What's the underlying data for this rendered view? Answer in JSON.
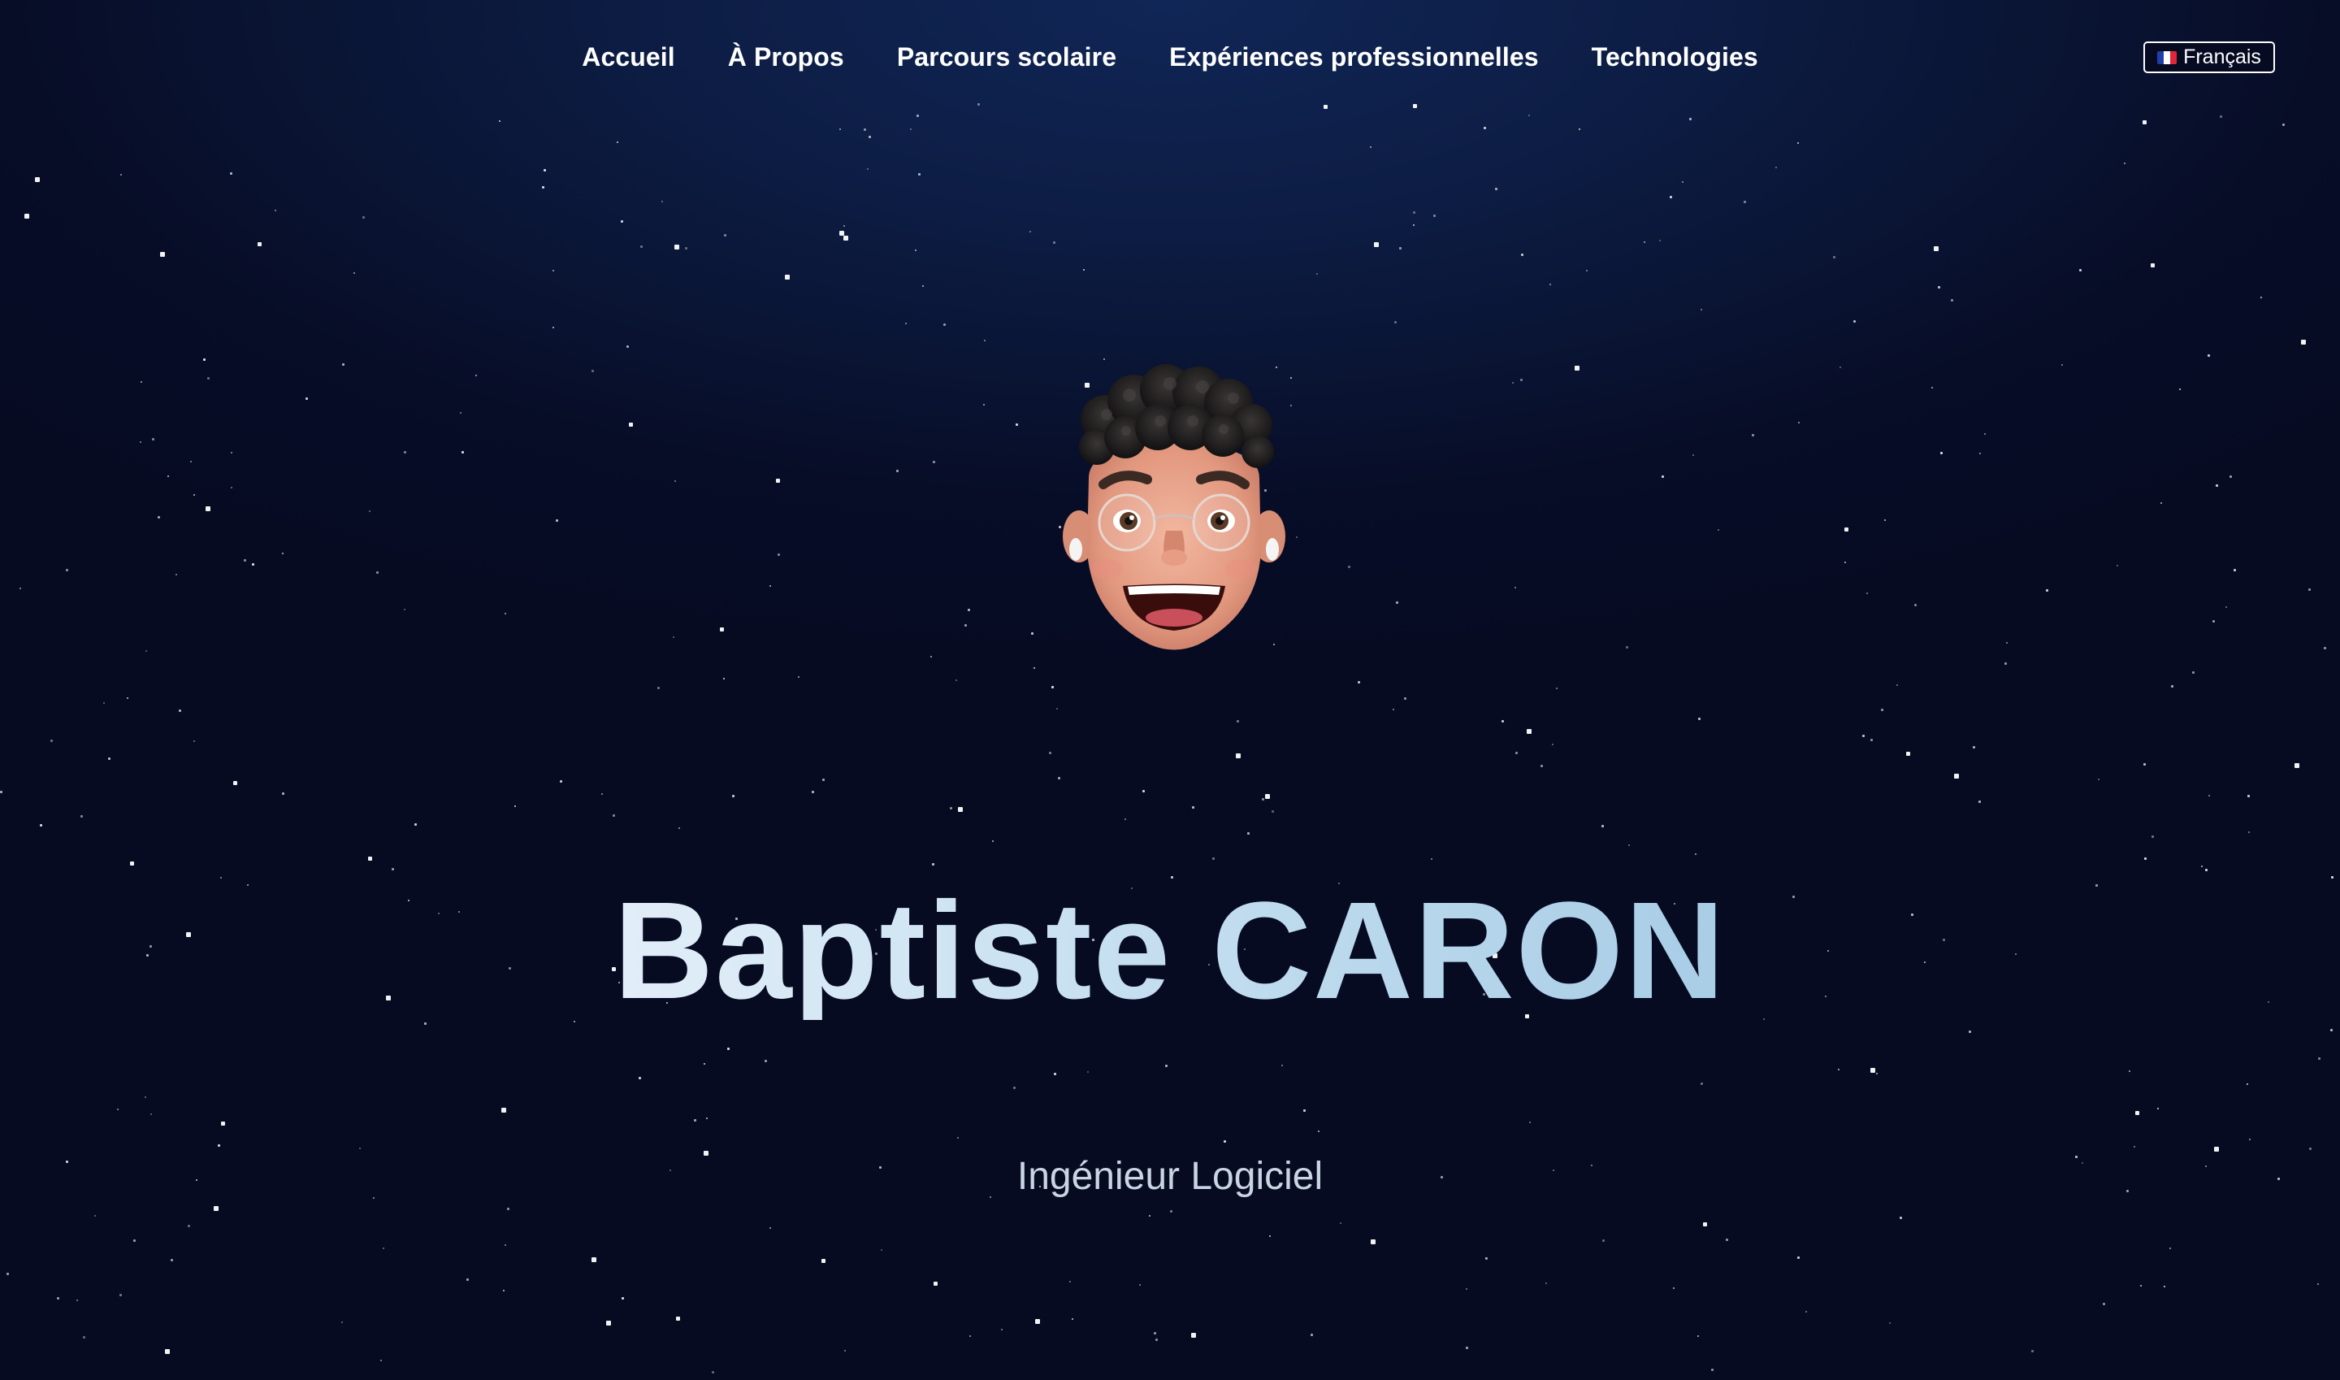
{
  "nav": {
    "items": [
      {
        "label": "Accueil"
      },
      {
        "label": "À Propos"
      },
      {
        "label": "Parcours scolaire"
      },
      {
        "label": "Expériences professionnelles"
      },
      {
        "label": "Technologies"
      }
    ]
  },
  "language": {
    "flag_icon": "french-flag-icon",
    "label": "Français"
  },
  "hero": {
    "avatar_icon": "memoji-avatar",
    "name": "Baptiste CARON",
    "subtitle": "Ingénieur Logiciel"
  },
  "colors": {
    "background_top": "#102656",
    "background_bottom": "#060b22",
    "name_gradient_start": "#e2eef8",
    "name_gradient_end": "#a8cde6",
    "subtitle": "#c9d5e3"
  }
}
